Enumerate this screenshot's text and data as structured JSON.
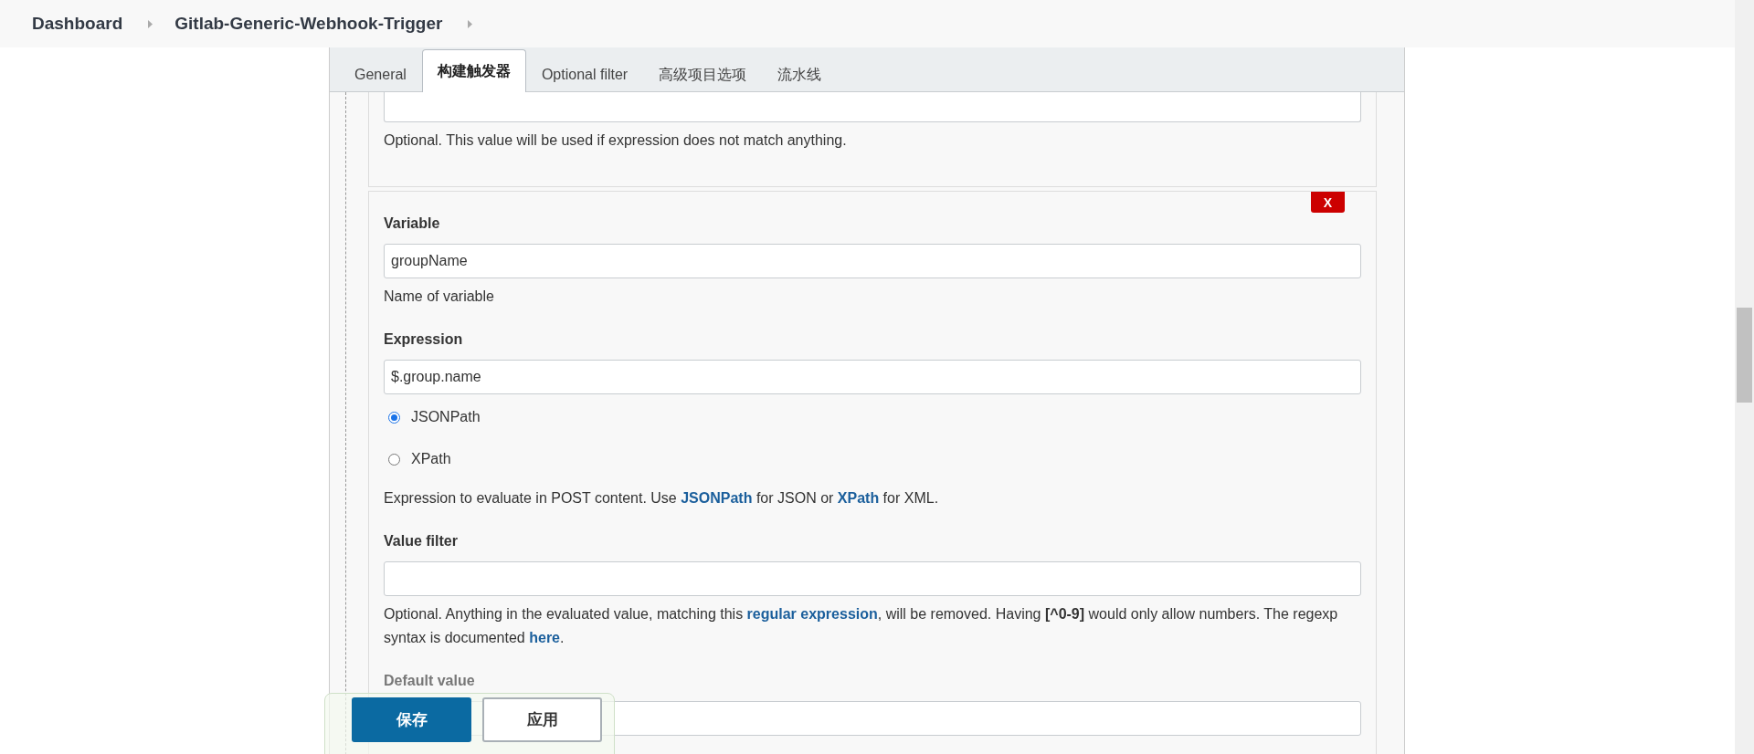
{
  "breadcrumb": [
    {
      "label": "Dashboard"
    },
    {
      "label": "Gitlab-Generic-Webhook-Trigger"
    }
  ],
  "tabs": [
    {
      "label": "General",
      "selected": false
    },
    {
      "label": "构建触发器",
      "selected": true
    },
    {
      "label": "Optional filter",
      "selected": false
    },
    {
      "label": "高级项目选项",
      "selected": false
    },
    {
      "label": "流水线",
      "selected": false
    }
  ],
  "previous_section": {
    "help": "Optional. This value will be used if expression does not match anything."
  },
  "variable_section": {
    "delete_button": "X",
    "variable": {
      "label": "Variable",
      "value": "groupName",
      "help": "Name of variable"
    },
    "expression": {
      "label": "Expression",
      "value": "$.group.name",
      "options": [
        {
          "label": "JSONPath",
          "selected": true
        },
        {
          "label": "XPath",
          "selected": false
        }
      ],
      "help": [
        {
          "kind": "text",
          "text": "Expression to evaluate in POST content. Use "
        },
        {
          "kind": "link",
          "text": "JSONPath"
        },
        {
          "kind": "text",
          "text": " for JSON or "
        },
        {
          "kind": "link",
          "text": "XPath"
        },
        {
          "kind": "text",
          "text": " for XML."
        }
      ]
    },
    "value_filter": {
      "label": "Value filter",
      "help": [
        {
          "kind": "text",
          "text": "Optional. Anything in the evaluated value, matching this "
        },
        {
          "kind": "link",
          "text": "regular expression"
        },
        {
          "kind": "text",
          "text": ", will be removed. Having "
        },
        {
          "kind": "bold",
          "text": "[^0-9]"
        },
        {
          "kind": "text",
          "text": " would only allow numbers. The regexp syntax is documented "
        },
        {
          "kind": "link",
          "text": "here"
        },
        {
          "kind": "text",
          "text": "."
        }
      ]
    },
    "default_value": {
      "label": "Default value"
    }
  },
  "save_bar": {
    "buttons": [
      {
        "label": "保存",
        "kind": "primary"
      },
      {
        "label": "应用",
        "kind": "secondary"
      }
    ]
  }
}
